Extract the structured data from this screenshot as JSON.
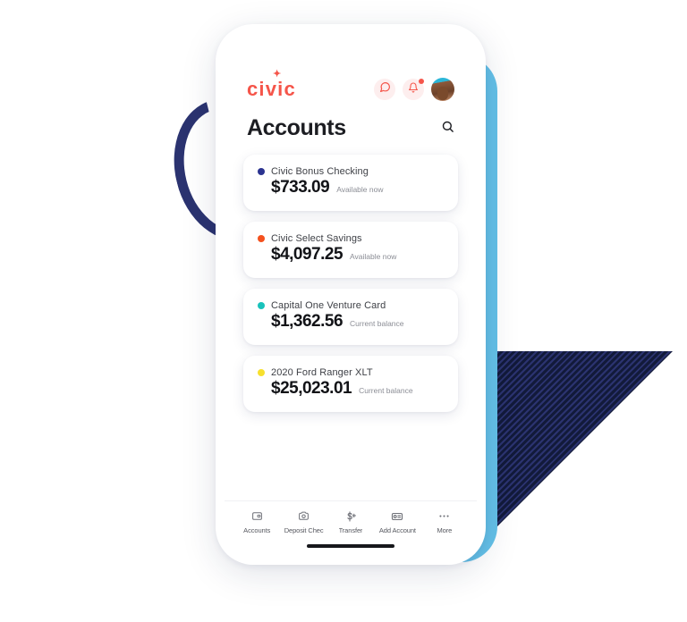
{
  "brand": {
    "logo_text": "civic",
    "logo_color": "#f5554a",
    "star_glyph": "✦"
  },
  "header": {
    "chat_icon": "chat-bubble-icon",
    "bell_icon": "bell-icon",
    "avatar_icon": "user-avatar",
    "has_notification": true
  },
  "page": {
    "title": "Accounts",
    "search_icon": "search-icon"
  },
  "accounts": [
    {
      "name": "Civic Bonus Checking",
      "amount": "$733.09",
      "caption": "Available now",
      "dot_color": "#2b3390"
    },
    {
      "name": "Civic Select Savings",
      "amount": "$4,097.25",
      "caption": "Available now",
      "dot_color": "#f4511e"
    },
    {
      "name": "Capital One Venture Card",
      "amount": "$1,362.56",
      "caption": "Current balance",
      "dot_color": "#19c2bb"
    },
    {
      "name": "2020 Ford Ranger XLT",
      "amount": "$25,023.01",
      "caption": "Current balance",
      "dot_color": "#f7e02e"
    }
  ],
  "tabbar": [
    {
      "label": "Accounts",
      "icon": "wallet-icon"
    },
    {
      "label": "Deposit Chec",
      "icon": "camera-icon"
    },
    {
      "label": "Transfer",
      "icon": "dollar-transfer-icon"
    },
    {
      "label": "Add Account",
      "icon": "add-card-icon"
    },
    {
      "label": "More",
      "icon": "ellipsis-icon"
    }
  ],
  "decor": {
    "arc_color": "#2b3370",
    "slab_color": "#64c1e8",
    "hatch_color": "#2b3370"
  }
}
